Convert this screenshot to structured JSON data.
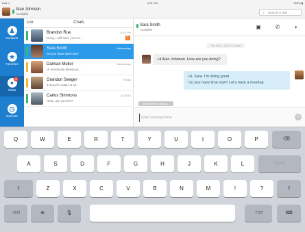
{
  "status_bar": {
    "left": "Pad ᯤ",
    "time": "4:21 PM",
    "right": "100% ▮"
  },
  "me": {
    "name": "Alan Johnson",
    "status": "Available"
  },
  "search": {
    "placeholder": "Search or ask",
    "icon": "magnifier-icon"
  },
  "sidebar": {
    "items": [
      {
        "label": "Contacts",
        "icon": "person-icon",
        "glyph": "♟"
      },
      {
        "label": "Favorites",
        "icon": "star-icon",
        "glyph": "★"
      },
      {
        "label": "Chats",
        "icon": "chat-bubble-icon",
        "glyph": "●",
        "badge": "8",
        "active": true
      },
      {
        "label": "Recents",
        "icon": "clock-icon",
        "glyph": "◷"
      }
    ]
  },
  "chat_list": {
    "edit_label": "Edit",
    "title": "Chats",
    "rows": [
      {
        "name": "Brandon Rue",
        "message": "Doug, I still have your fo...",
        "time": "6:18 PM",
        "unread": "1"
      },
      {
        "name": "Sara Smith",
        "message": "Do you have time now?",
        "time": "Wednesday",
        "selected": true
      },
      {
        "name": "Damian Muller",
        "message": "Hi everybody please joi...",
        "time": "Wednesday"
      },
      {
        "name": "Grandon Seeger",
        "message": "It doesn't matter at all...",
        "time": "Friday"
      },
      {
        "name": "Carlos Simmons",
        "message": "Hello, are you free?",
        "time": "11/26/13"
      }
    ]
  },
  "conversation": {
    "name": "Sara Smith",
    "status": "Available",
    "date": "Tue Oct 1, 2013 3:33 pm",
    "incoming": "Hi Alan Johnson. How are you doing?",
    "outgoing_line1": "Hi, Sara. I'm doing great",
    "outgoing_line2": "Do you have time now? Let's have a meeting.",
    "typing": "Sara Smith is typing...",
    "compose_placeholder": "Enter message here"
  },
  "keyboard": {
    "row1": [
      "Q",
      "W",
      "E",
      "R",
      "T",
      "Y",
      "U",
      "I",
      "O",
      "P"
    ],
    "backspace": "⌫",
    "row2": [
      "A",
      "S",
      "D",
      "F",
      "G",
      "H",
      "J",
      "K",
      "L"
    ],
    "search": "Search",
    "row3": [
      "Z",
      "X",
      "C",
      "V",
      "B",
      "N",
      "M",
      "!",
      "?"
    ],
    "shift": "⇧",
    "numbers": ".?123",
    "globe": "⊕",
    "mic": "🎙",
    "hide": "⌨"
  },
  "colors": {
    "accent": "#1e7fd0",
    "selected_row": "#2b9ae8",
    "presence": "#3cb371",
    "unread": "#f27a2e"
  }
}
